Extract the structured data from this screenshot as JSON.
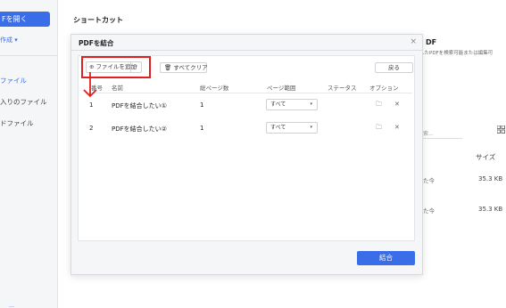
{
  "sidebar": {
    "open_button": "Fを開く",
    "create_link": "作成 ▾",
    "items": [
      "ファイル",
      "入りのファイル",
      "ドファイル"
    ],
    "bottom": "…"
  },
  "main": {
    "shortcut_title": "ショートカット",
    "pdf_heading": "DF",
    "pdf_desc": "したPDFを検索可能または編集可",
    "search_hint": "索...",
    "size_header": "サイズ",
    "rows": [
      {
        "time": "た今",
        "size": "35.3 KB"
      },
      {
        "time": "た今",
        "size": "35.3 KB"
      }
    ]
  },
  "dialog": {
    "title": "PDFを結合",
    "close": "×",
    "toolbar": {
      "add_label": "ファイルを追加",
      "clear_label": "すべてクリア",
      "back_label": "戻る"
    },
    "columns": [
      "番号",
      "名前",
      "総ページ数",
      "ページ範囲",
      "ステータス",
      "オプション"
    ],
    "files": [
      {
        "no": "1",
        "name": "PDFを結合したい①",
        "pages": "1",
        "range": "すべて"
      },
      {
        "no": "2",
        "name": "PDFを結合したい②",
        "pages": "1",
        "range": "すべて"
      }
    ],
    "merge_label": "結合"
  },
  "colors": {
    "accent": "#3a6ee8",
    "highlight": "#e02020"
  }
}
